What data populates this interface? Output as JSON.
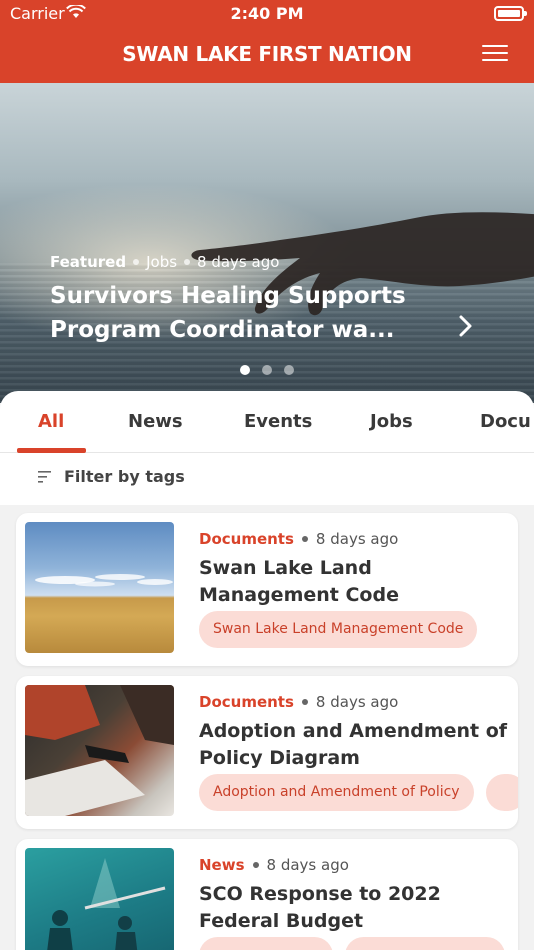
{
  "status_bar": {
    "carrier": "Carrier",
    "time": "2:40 PM"
  },
  "header": {
    "title": "SWAN LAKE FIRST NATION",
    "menu_icon": "hamburger-icon"
  },
  "hero": {
    "badge": "Featured",
    "category": "Jobs",
    "age": "8 days ago",
    "title": "Survivors Healing Supports Program Coordinator wa...",
    "page_count": 3,
    "active_page": 1
  },
  "tabs": [
    {
      "label": "All",
      "active": true
    },
    {
      "label": "News",
      "active": false
    },
    {
      "label": "Events",
      "active": false
    },
    {
      "label": "Jobs",
      "active": false
    },
    {
      "label": "Docu",
      "active": false
    }
  ],
  "filter": {
    "label": "Filter by tags"
  },
  "posts": [
    {
      "category": "Documents",
      "age": "8 days ago",
      "title": "Swan Lake Land Management Code",
      "tags": [
        "Swan Lake Land Management Code"
      ]
    },
    {
      "category": "Documents",
      "age": "8 days ago",
      "title": "Adoption and Amendment of Policy Diagram",
      "tags": [
        "Adoption and Amendment of Policy",
        ""
      ]
    },
    {
      "category": "News",
      "age": "8 days ago",
      "title": "SCO Response to 2022 Federal Budget",
      "tags": [
        "",
        ""
      ]
    }
  ],
  "colors": {
    "brand": "#d9432a",
    "tag_bg": "#fbdcd6"
  }
}
